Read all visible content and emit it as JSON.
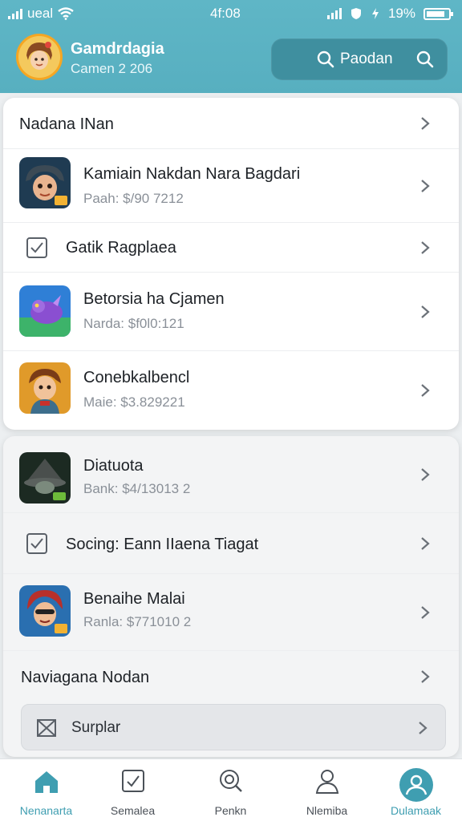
{
  "status_bar": {
    "carrier": "ueal",
    "time": "4f:08",
    "battery": "19%"
  },
  "header": {
    "title": "Gamdrdagia",
    "subtitle": "Camen 2 206",
    "search_label": "Paodan"
  },
  "card1": {
    "section_title": "Nadana INan",
    "rows": [
      {
        "title": "Kamiain Nakdan Nara Bagdari",
        "subtitle": "Paah: $/90 7212"
      },
      {
        "title": "Gatik Ragplaea"
      },
      {
        "title": "Betorsia ha Cjamen",
        "subtitle": "Narda: $f0l0:121"
      },
      {
        "title": "Conebkalbencl",
        "subtitle": "Maie: $3.829221"
      }
    ]
  },
  "card2": {
    "rows": [
      {
        "title": "Diatuota",
        "subtitle": "Bank: $4/13013 2"
      },
      {
        "title": "Socing: Eann IIaena Tiagat"
      },
      {
        "title": "Benaihe Malai",
        "subtitle": "Ranla: $771010 2"
      },
      {
        "title": "Naviagana Nodan"
      }
    ],
    "support_label": "Surplar"
  },
  "bottom_nav": [
    {
      "label": "Nenanarta",
      "icon": "home-icon"
    },
    {
      "label": "Semalea",
      "icon": "checklist-icon"
    },
    {
      "label": "Penkn",
      "icon": "search-chat-icon"
    },
    {
      "label": "Nlemiba",
      "icon": "user-icon"
    },
    {
      "label": "Dulamaak",
      "icon": "profile-icon",
      "active": true
    }
  ],
  "colors": {
    "header": "#5fb6c6",
    "search": "#3f8f9f",
    "active": "#3f9eb1"
  }
}
